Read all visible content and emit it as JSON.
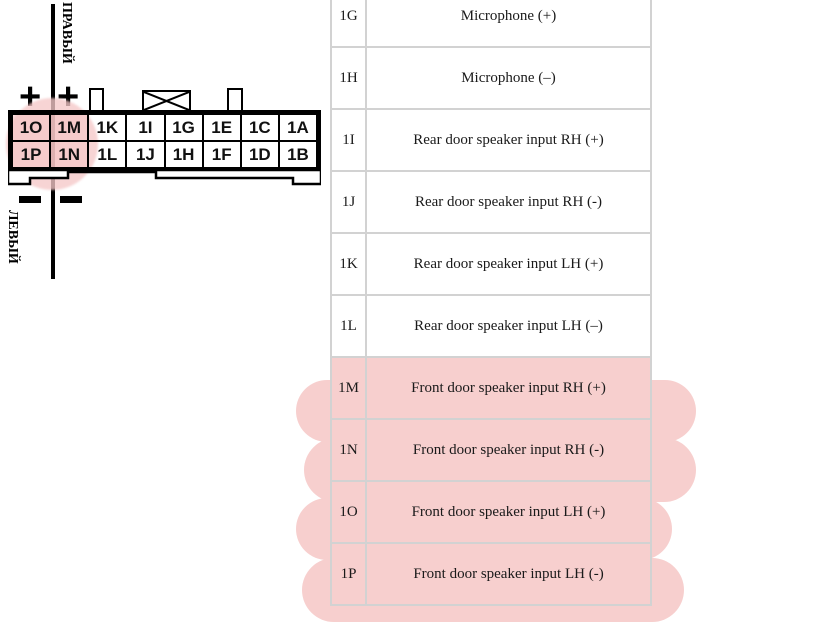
{
  "diagram": {
    "label_right": "ПРАВЫЙ",
    "label_left": "ЛЕВЫЙ",
    "polarity_plus": "+",
    "polarity_minus": "−",
    "highlight_color": "#f5c8c8",
    "pins_top_row": [
      "1O",
      "1M",
      "1K",
      "1I",
      "1G",
      "1E",
      "1C",
      "1A"
    ],
    "pins_bottom_row": [
      "1P",
      "1N",
      "1L",
      "1J",
      "1H",
      "1F",
      "1D",
      "1B"
    ],
    "highlighted_pins": [
      "1O",
      "1M",
      "1P",
      "1N"
    ]
  },
  "table": {
    "highlight_color": "#f7cfce",
    "rows": [
      {
        "pin": "",
        "description": "",
        "highlighted": false,
        "partial": true
      },
      {
        "pin": "1G",
        "description": "Microphone (+)",
        "highlighted": false
      },
      {
        "pin": "1H",
        "description": "Microphone (–)",
        "highlighted": false
      },
      {
        "pin": "1I",
        "description": "Rear door speaker input RH (+)",
        "highlighted": false
      },
      {
        "pin": "1J",
        "description": "Rear door speaker input RH (-)",
        "highlighted": false
      },
      {
        "pin": "1K",
        "description": "Rear door speaker input LH (+)",
        "highlighted": false
      },
      {
        "pin": "1L",
        "description": "Rear door speaker input LH (–)",
        "highlighted": false
      },
      {
        "pin": "1M",
        "description": "Front door speaker input RH (+)",
        "highlighted": true
      },
      {
        "pin": "1N",
        "description": "Front door speaker input RH (-)",
        "highlighted": true
      },
      {
        "pin": "1O",
        "description": "Front door speaker input LH (+)",
        "highlighted": true
      },
      {
        "pin": "1P",
        "description": "Front door speaker input LH (-)",
        "highlighted": true
      }
    ]
  }
}
